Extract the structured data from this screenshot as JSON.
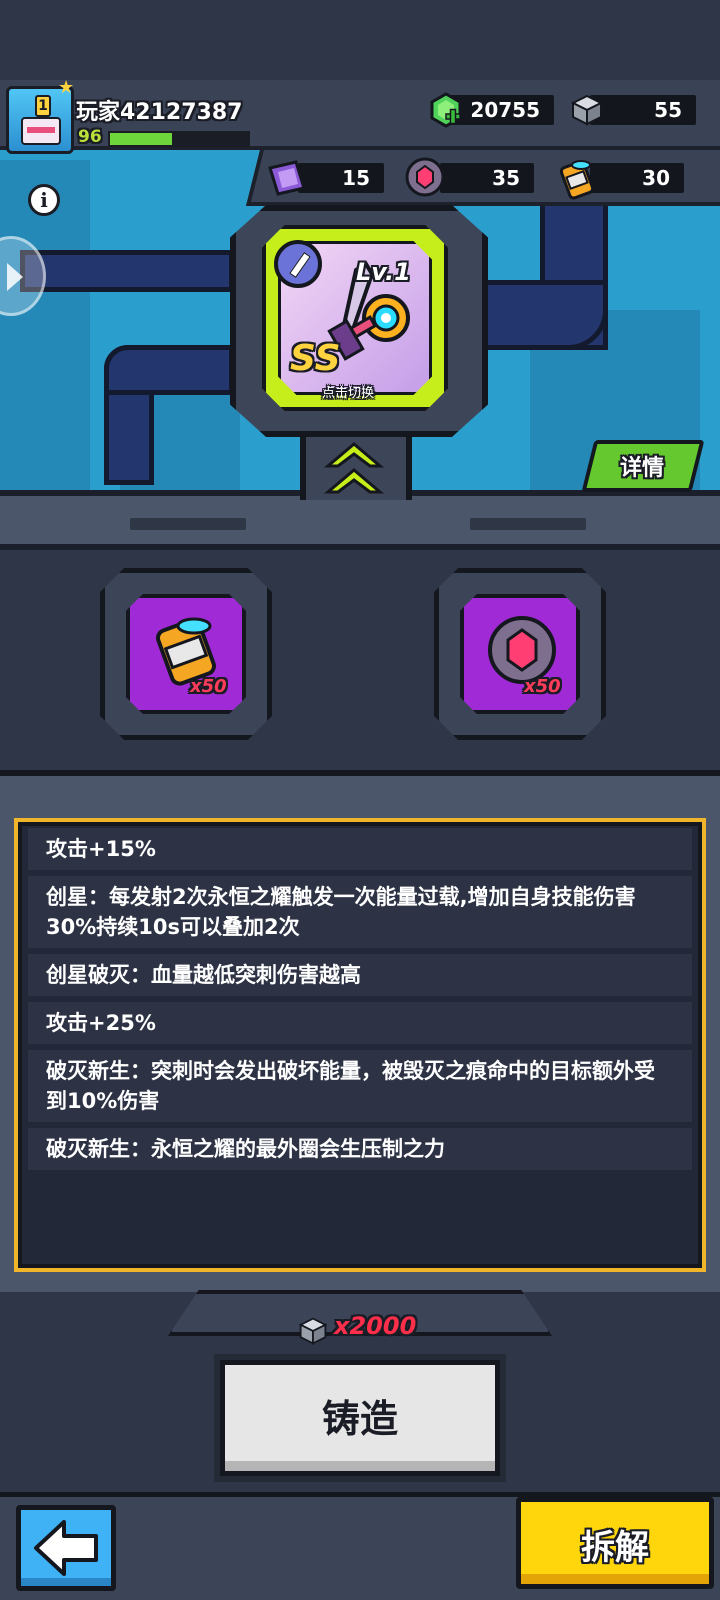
{
  "player": {
    "name": "玩家42127387",
    "level": "96",
    "xp_fraction": 0.45
  },
  "currencies": {
    "gems": "20755",
    "cubes": "55"
  },
  "materials": [
    {
      "icon": "crystal-icon",
      "count": "15"
    },
    {
      "icon": "gem-core-icon",
      "count": "35"
    },
    {
      "icon": "canister-icon",
      "count": "30"
    }
  ],
  "weapon": {
    "level": "Lv.1",
    "grade": "SS",
    "tap_hint": "点击切换"
  },
  "details_label": "详情",
  "sockets": [
    {
      "icon": "canister-icon",
      "count": "x50"
    },
    {
      "icon": "gem-core-icon",
      "count": "x50"
    }
  ],
  "effects": [
    "攻击+15%",
    "创星：每发射2次永恒之耀触发一次能量过载,增加自身技能伤害30%持续10s可以叠加2次",
    "创星破灭：血量越低突刺伤害越高",
    "攻击+25%",
    "破灭新生：突刺时会发出破坏能量，被毁灭之痕命中的目标额外受到10%伤害",
    "破灭新生：永恒之耀的最外圈会生压制之力"
  ],
  "cost": "x2000",
  "forge_label": "铸造",
  "disassemble_label": "拆解",
  "colors": {
    "accent_green": "#c6ee1a",
    "panel_border": "#f0b52a",
    "cost_red": "#ff2e4a",
    "socket_purple": "#a02bd6"
  }
}
